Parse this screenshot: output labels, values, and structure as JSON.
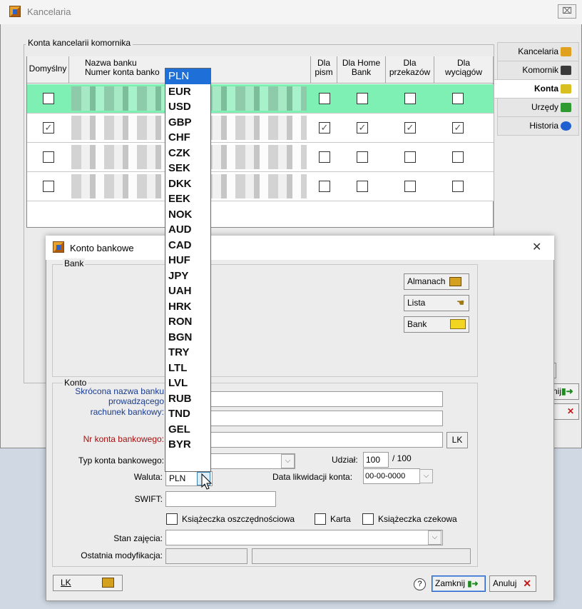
{
  "outer": {
    "title": "Kancelaria",
    "close_glyph": "⌧",
    "group_label": "Konta kancelarii komornika",
    "columns": [
      "Domyślny",
      "Nazwa banku\nNumer konta banko",
      "Dla\npism",
      "Dla Home\nBank",
      "Dla\nprzekazów",
      "Dla\nwyciągów"
    ],
    "rows": [
      {
        "highlight": true,
        "domyslny": false,
        "pism": false,
        "home": false,
        "przekazow": false,
        "wyciagow": false
      },
      {
        "highlight": false,
        "domyslny": true,
        "pism": true,
        "home": true,
        "przekazow": true,
        "wyciagow": true
      },
      {
        "highlight": false,
        "domyslny": false,
        "pism": false,
        "home": false,
        "przekazow": false,
        "wyciagow": false
      },
      {
        "highlight": false,
        "domyslny": false,
        "pism": false,
        "home": false,
        "przekazow": false,
        "wyciagow": false
      }
    ],
    "tabs": [
      {
        "label": "Kancelaria",
        "icon": "desk-icon"
      },
      {
        "label": "Komornik",
        "icon": "person-icon"
      },
      {
        "label": "Konta",
        "icon": "money-icon",
        "active": true
      },
      {
        "label": "Urzędy",
        "icon": "building-icon"
      },
      {
        "label": "Historia",
        "icon": "info-icon"
      }
    ],
    "partial_button_label": "nij"
  },
  "dialog": {
    "title": "Konto bankowe",
    "close_glyph": "✕",
    "bank_group_label": "Bank",
    "bank_buttons": {
      "almanach": "Almanach",
      "lista": "Lista",
      "bank": "Bank"
    },
    "konto_group_label": "Konto",
    "labels": {
      "skrocona": "Skrócona nazwa banku",
      "prowadzacego": "prowadzącego",
      "rachunek": "rachunek bankowy:",
      "nr_konta": "Nr konta bankowego:",
      "typ_konta": "Typ konta bankowego:",
      "udzial": "Udział:",
      "udzial_total": "/ 100",
      "waluta": "Waluta:",
      "data_likwidacji": "Data likwidacji konta:",
      "swift": "SWIFT:",
      "stan_zajecia": "Stan zajęcia:",
      "ostatnia_modyfikacja": "Ostatnia modyfikacja:"
    },
    "values": {
      "udzial": "100",
      "waluta": "PLN",
      "data_likwidacji": "00-00-0000"
    },
    "checkboxes": {
      "ksiazeczka_oszcz": "Książeczka oszczędnościowa",
      "karta": "Karta",
      "ksiazeczka_czek": "Książeczka czekowa"
    },
    "lk_button": "LK",
    "footer": {
      "lk": "LK",
      "help_glyph": "?",
      "zamknij": "Zamknij",
      "anuluj": "Anuluj"
    }
  },
  "currency_dropdown": {
    "selected": "PLN",
    "options": [
      "PLN",
      "EUR",
      "USD",
      "GBP",
      "CHF",
      "CZK",
      "SEK",
      "DKK",
      "EEK",
      "NOK",
      "AUD",
      "CAD",
      "HUF",
      "JPY",
      "UAH",
      "HRK",
      "RON",
      "BGN",
      "TRY",
      "LTL",
      "LVL",
      "RUB",
      "TND",
      "GEL",
      "BYR"
    ]
  }
}
